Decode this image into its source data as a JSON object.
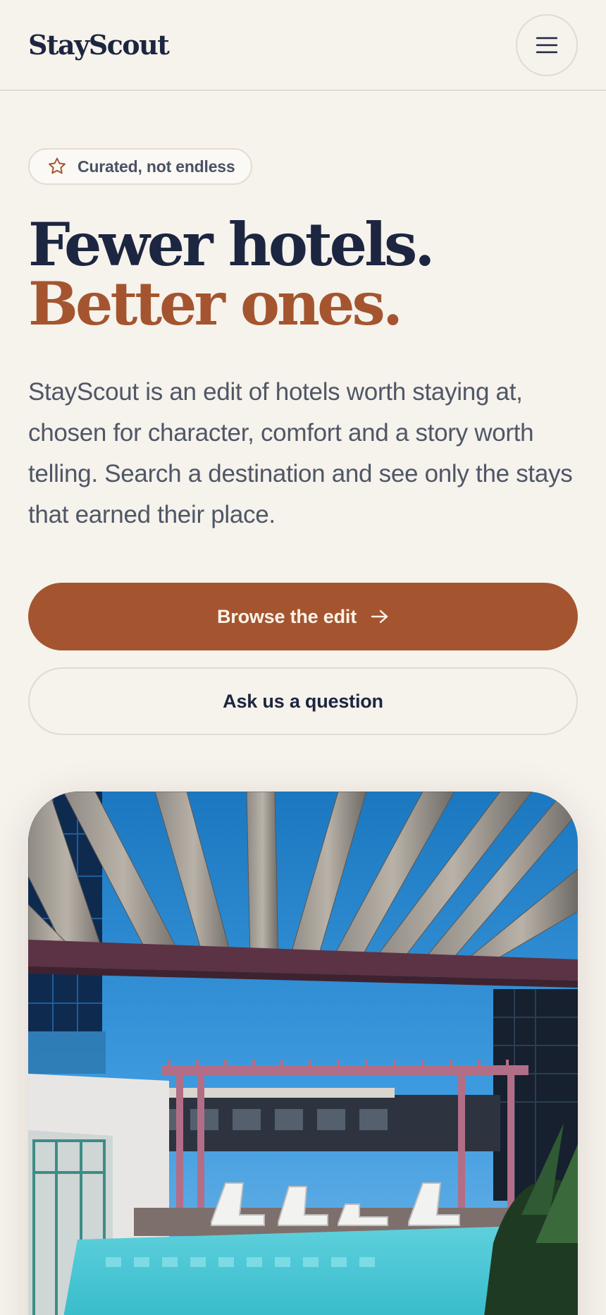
{
  "header": {
    "logo": "StayScout",
    "menu_icon": "hamburger-menu-icon"
  },
  "hero": {
    "badge": {
      "icon": "star-outline-icon",
      "label": "Curated, not endless"
    },
    "headline_line1": "Fewer hotels.",
    "headline_line2": "Better ones.",
    "lede": "StayScout is an edit of hotels worth staying at, chosen for character, comfort and a story worth telling. Search a destination and see only the stays that earned their place.",
    "primary_cta": {
      "label": "Browse the edit",
      "icon": "arrow-right-icon"
    },
    "secondary_cta": {
      "label": "Ask us a question"
    }
  },
  "image": {
    "subject": "rooftop-pool-pergola-photo"
  },
  "colors": {
    "background": "#f6f2ec",
    "ink": "#1c2640",
    "accent": "#a4552f",
    "muted_text": "#4f5766",
    "border": "#dedad4"
  }
}
